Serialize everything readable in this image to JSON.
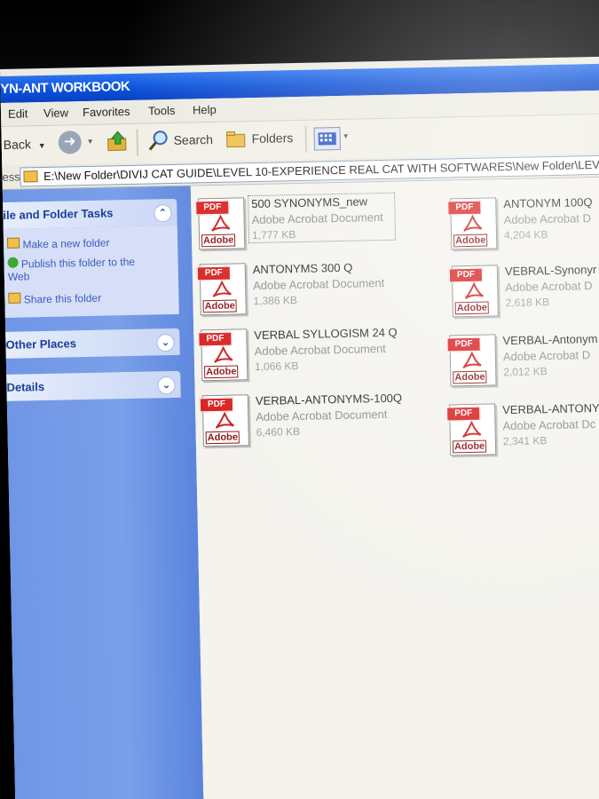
{
  "window": {
    "title": "YN-ANT WORKBOOK"
  },
  "menu": [
    "Edit",
    "View",
    "Favorites",
    "Tools",
    "Help"
  ],
  "toolbar": {
    "back_label": "Back",
    "search_label": "Search",
    "folders_label": "Folders"
  },
  "address": {
    "label": "ess",
    "path": "E:\\New Folder\\DIVIJ CAT GUIDE\\LEVEL 10-EXPERIENCE REAL CAT WITH SOFTWARES\\New Folder\\LEV"
  },
  "sidebar": {
    "file_folder_tasks": {
      "title": "ile and Folder Tasks",
      "items": [
        "Make a new folder",
        "Publish this folder to the Web",
        "Share this folder"
      ]
    },
    "other_places": {
      "title": "Other Places"
    },
    "details": {
      "title": "Details"
    }
  },
  "files": [
    {
      "name": "500 SYNONYMS_new",
      "type": "Adobe Acrobat Document",
      "size": "1,777 KB",
      "selected": true
    },
    {
      "name": "ANTONYM 100Q",
      "type": "Adobe Acrobat D",
      "size": "4,204 KB"
    },
    {
      "name": "ANTONYMS 300 Q",
      "type": "Adobe Acrobat Document",
      "size": "1,386 KB"
    },
    {
      "name": "VEBRAL-Synonyr",
      "type": "Adobe Acrobat D",
      "size": "2,618 KB"
    },
    {
      "name": "VERBAL SYLLOGISM 24 Q",
      "type": "Adobe Acrobat Document",
      "size": "1,066 KB"
    },
    {
      "name": "VERBAL-Antonym",
      "type": "Adobe Acrobat D",
      "size": "2,012 KB"
    },
    {
      "name": "VERBAL-ANTONYMS-100Q",
      "type": "Adobe Acrobat Document",
      "size": "6,460 KB"
    },
    {
      "name": "VERBAL-ANTONYN",
      "type": "Adobe Acrobat Dc",
      "size": "2,341 KB"
    }
  ],
  "icon": {
    "pdf_tag": "PDF",
    "adobe_label": "Adobe"
  }
}
